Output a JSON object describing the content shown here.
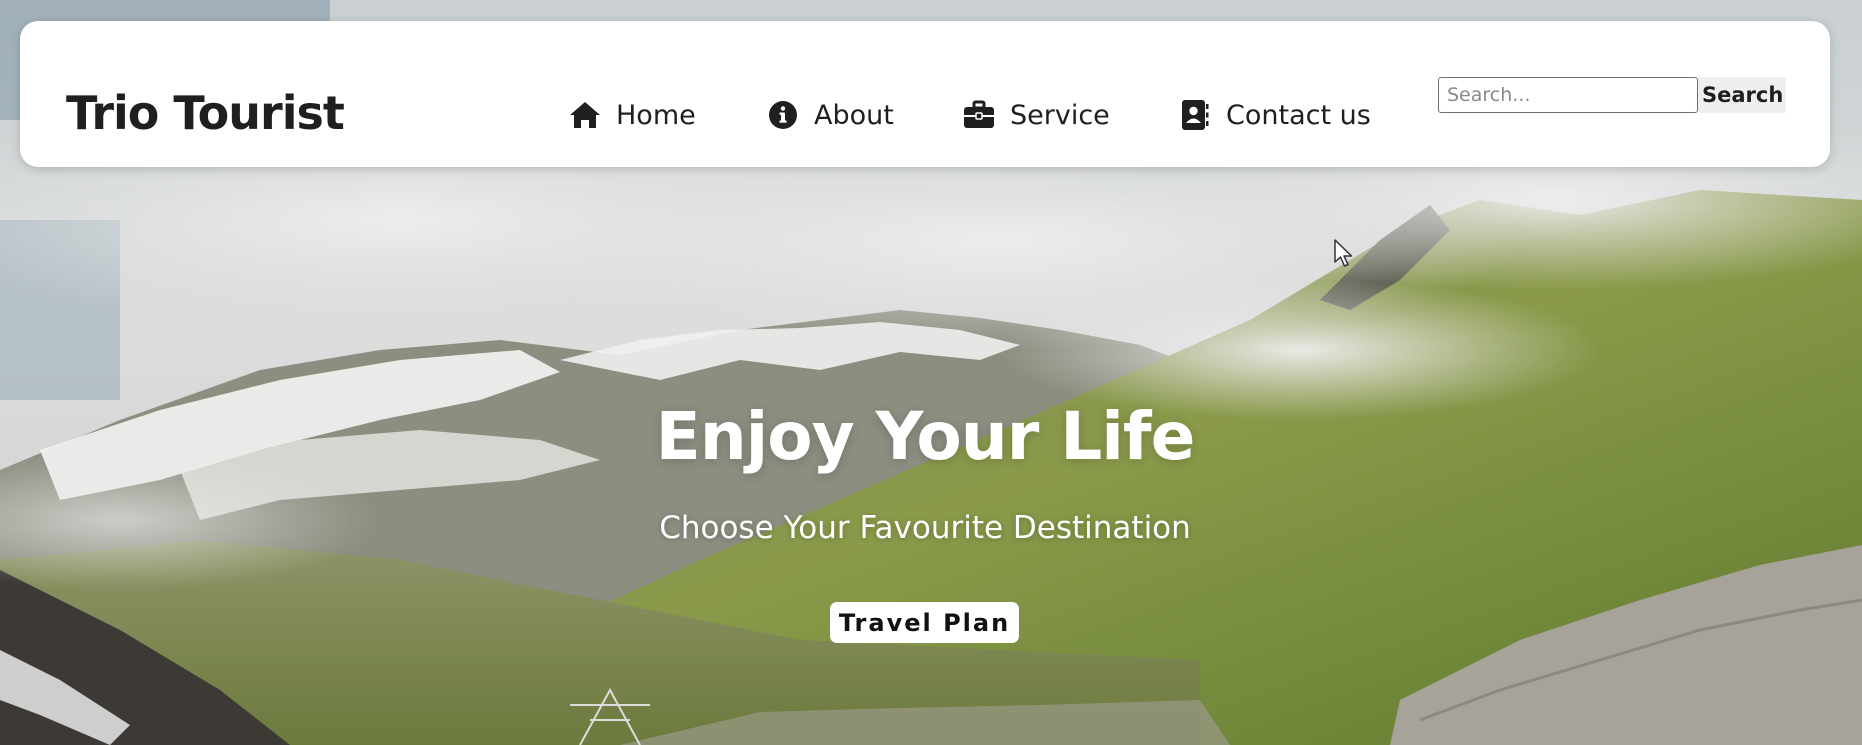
{
  "header": {
    "brand": "Trio Tourist",
    "nav": [
      {
        "label": "Home",
        "icon": "home-icon"
      },
      {
        "label": "About",
        "icon": "info-icon"
      },
      {
        "label": "Service",
        "icon": "briefcase-icon"
      },
      {
        "label": "Contact us",
        "icon": "contact-book-icon"
      }
    ],
    "search": {
      "placeholder": "Search...",
      "value": "",
      "button_label": "Search"
    }
  },
  "hero": {
    "title": "Enjoy Your Life",
    "subtitle": "Choose Your Favourite Destination",
    "cta_label": "Travel Plan",
    "background": "mountain-valley-photo"
  },
  "colors": {
    "navbar_bg": "#ffffff",
    "text_dark": "#1f1f1f",
    "hero_text": "#ffffff"
  }
}
